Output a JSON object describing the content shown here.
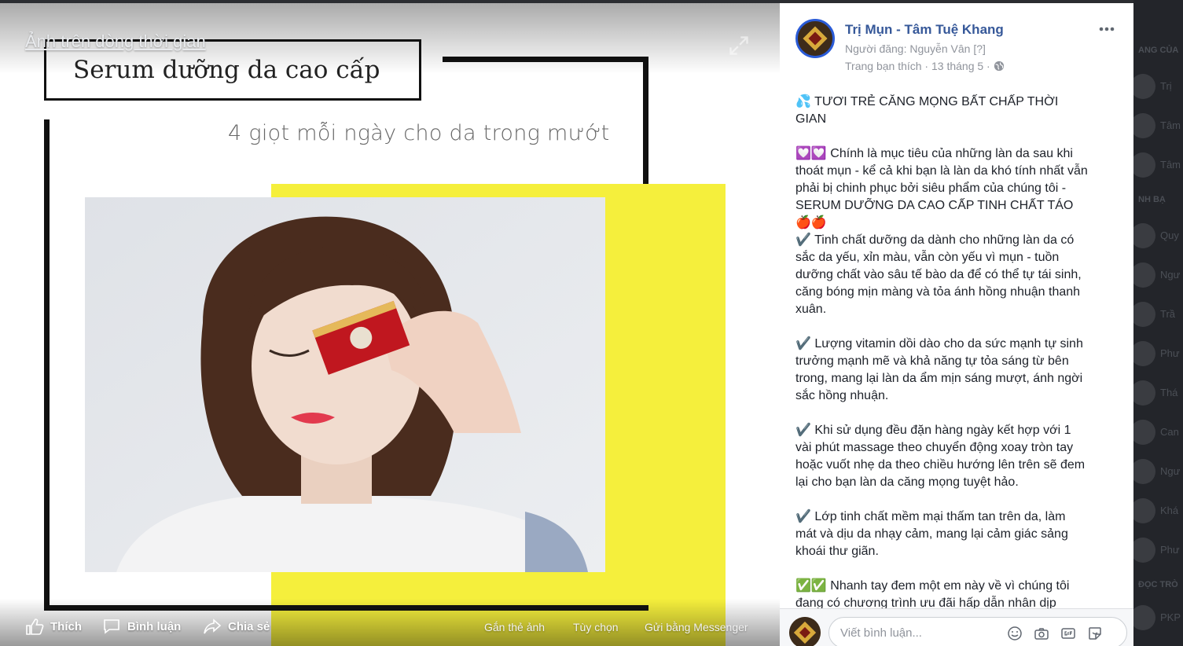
{
  "viewer": {
    "label": "Ảnh trên dòng thời gian",
    "image": {
      "title": "Serum dưỡng da cao cấp",
      "subtitle": "4 giọt mỗi ngày cho da trong mướt"
    },
    "actions": {
      "like": "Thích",
      "comment": "Bình luận",
      "share": "Chia sẻ"
    },
    "links": {
      "tag": "Gắn thẻ ảnh",
      "options": "Tùy chọn",
      "messenger": "Gửi bằng Messenger"
    }
  },
  "post": {
    "page_name": "Trị Mụn - Tâm Tuệ Khang",
    "poster": "Người đăng: Nguyễn Vân [?]",
    "meta": "Trang bạn thích · 13 tháng 5 ·",
    "paragraphs": [
      [
        "💦 TƯƠI TRẺ CĂNG MỌNG BẤT CHẤP THỜI",
        "GIAN"
      ],
      [
        "💟💟 Chính là mục tiêu của những làn da sau khi",
        "thoát mụn - kể cả khi bạn là làn da khó tính nhất vẫn",
        "phải bị chinh phục bởi siêu phẩm của chúng tôi -",
        "SERUM DƯỠNG DA CAO CẤP TINH CHẤT TÁO",
        "🍎🍎",
        "✔️ Tinh chất dưỡng da dành cho những làn da có",
        "sắc da yếu, xỉn màu, vẫn còn yếu vì mụn - tuồn",
        "dưỡng chất vào sâu tế bào da để có thể tự tái sinh,",
        "căng bóng mịn màng và tỏa ánh hồng nhuận thanh",
        "xuân."
      ],
      [
        "✔️ Lượng vitamin dồi dào cho da sức mạnh tự sinh",
        "trưởng mạnh mẽ và khả năng tự tỏa sáng từ bên",
        "trong, mang lại làn da ẩm mịn sáng mượt, ánh ngời",
        "sắc hồng nhuận."
      ],
      [
        "✔️ Khi sử dụng đều đặn hàng ngày kết hợp với 1",
        "vài phút massage theo chuyển động xoay tròn tay",
        "hoặc vuốt nhẹ da theo chiều hướng lên trên sẽ đem",
        "lại cho bạn làn da căng mọng tuyệt hảo."
      ],
      [
        "✔️ Lớp tinh chất mềm mại thấm tan trên da, làm",
        "mát và dịu da nhạy cảm, mang lại cảm giác sảng",
        "khoái thư giãn."
      ],
      [
        "✅✅ Nhanh tay đem một em này về vì chúng tôi",
        "đang có chương trình ưu đãi hấp dẫn nhân dịp"
      ]
    ],
    "comment_placeholder": "Viết bình luận..."
  },
  "background_sidebar": {
    "headings": [
      "ANG CỦA",
      "NH BẠ",
      "ĐỌC TRÒ"
    ],
    "names": [
      "Trị",
      "Tâm",
      "Tâm",
      "Quy",
      "Ngư",
      "Trầ",
      "Phư",
      "Thá",
      "Can",
      "Ngư",
      "Khá",
      "Phư",
      "PKP"
    ]
  },
  "colors": {
    "facebook_blue": "#365899",
    "yellow_block": "#f5ef3c",
    "meta_gray": "#90949c"
  }
}
